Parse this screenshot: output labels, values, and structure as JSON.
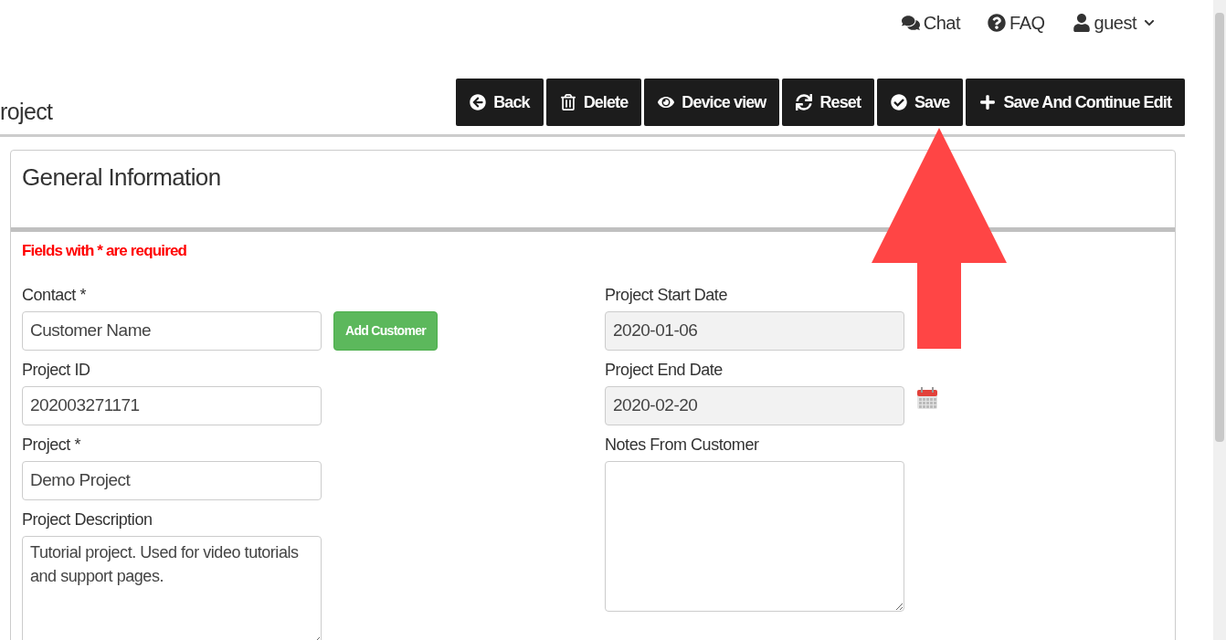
{
  "header": [
    {
      "kind": "chat",
      "label": "Chat"
    },
    {
      "kind": "faq",
      "label": "FAQ"
    },
    {
      "kind": "user",
      "label": "guest"
    }
  ],
  "page_title": "roject",
  "toolbar": [
    {
      "kind": "back",
      "label": "Back"
    },
    {
      "kind": "delete",
      "label": "Delete"
    },
    {
      "kind": "view",
      "label": "Device view"
    },
    {
      "kind": "reset",
      "label": "Reset"
    },
    {
      "kind": "save",
      "label": "Save"
    },
    {
      "kind": "add",
      "label": "Save And Continue Edit"
    }
  ],
  "panel": {
    "title": "General Information",
    "required_note": "Fields with * are required",
    "left_fields": [
      {
        "kind": "text",
        "label": "Contact *",
        "placeholder": "Customer Name",
        "button": "Add Customer"
      },
      {
        "kind": "text",
        "label": "Project ID",
        "value": "202003271171"
      },
      {
        "kind": "text",
        "label": "Project *",
        "value": "Demo Project"
      },
      {
        "kind": "textarea",
        "label": "Project Description",
        "value": "Tutorial project. Used for video tutorials and support pages."
      }
    ],
    "right_fields": [
      {
        "kind": "date",
        "label": "Project Start Date",
        "value": "2020-01-06"
      },
      {
        "kind": "date",
        "label": "Project End Date",
        "value": "2020-02-20"
      },
      {
        "kind": "textarea",
        "label": "Notes From Customer"
      }
    ]
  }
}
